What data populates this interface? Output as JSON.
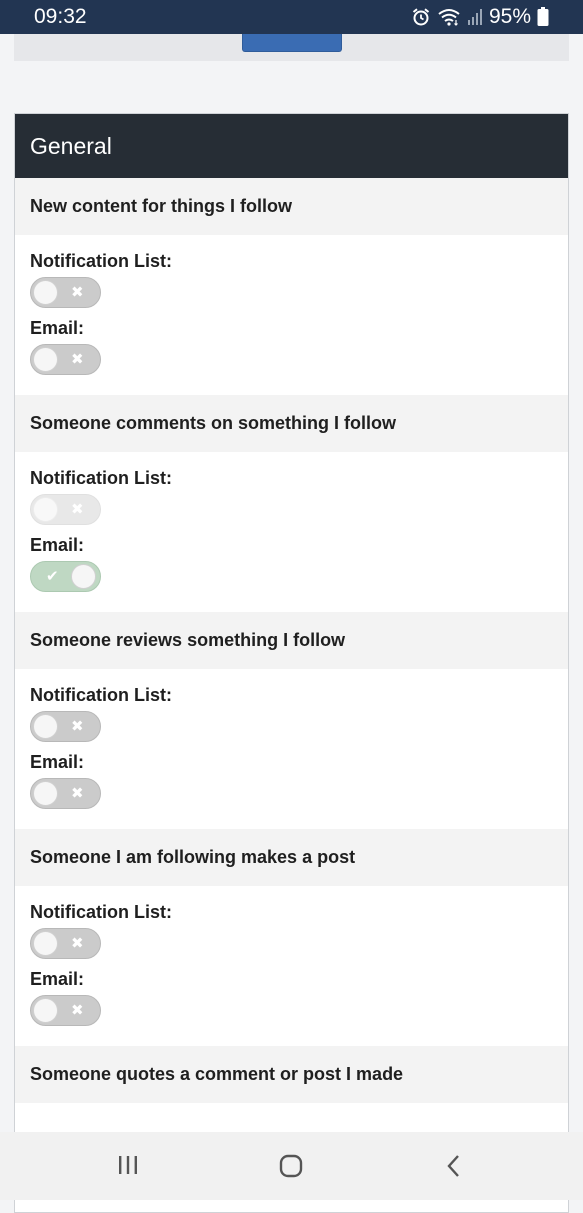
{
  "status_bar": {
    "time": "09:32",
    "battery": "95%",
    "icons": [
      "alarm-icon",
      "wifi-icon",
      "signal-icon",
      "battery-icon"
    ]
  },
  "panel": {
    "title": "General",
    "groups": [
      {
        "title": "New content for things I follow",
        "fields": [
          {
            "label": "Notification List:",
            "state": "off"
          },
          {
            "label": "Email:",
            "state": "off"
          }
        ]
      },
      {
        "title": "Someone comments on something I follow",
        "fields": [
          {
            "label": "Notification List:",
            "state": "disabled"
          },
          {
            "label": "Email:",
            "state": "on"
          }
        ]
      },
      {
        "title": "Someone reviews something I follow",
        "fields": [
          {
            "label": "Notification List:",
            "state": "off"
          },
          {
            "label": "Email:",
            "state": "off"
          }
        ]
      },
      {
        "title": "Someone I am following makes a post",
        "fields": [
          {
            "label": "Notification List:",
            "state": "off"
          },
          {
            "label": "Email:",
            "state": "off"
          }
        ]
      },
      {
        "title": "Someone quotes a comment or post I made",
        "fields": []
      }
    ]
  },
  "nav_bar": {
    "buttons": [
      "recents-icon",
      "home-icon",
      "back-icon"
    ]
  },
  "colors": {
    "status_bar_bg": "#223552",
    "panel_header_bg": "#262d35",
    "toggle_on": "#bfd8c3",
    "toggle_off": "#cbcbcb",
    "primary_button": "#3a6cb3"
  }
}
